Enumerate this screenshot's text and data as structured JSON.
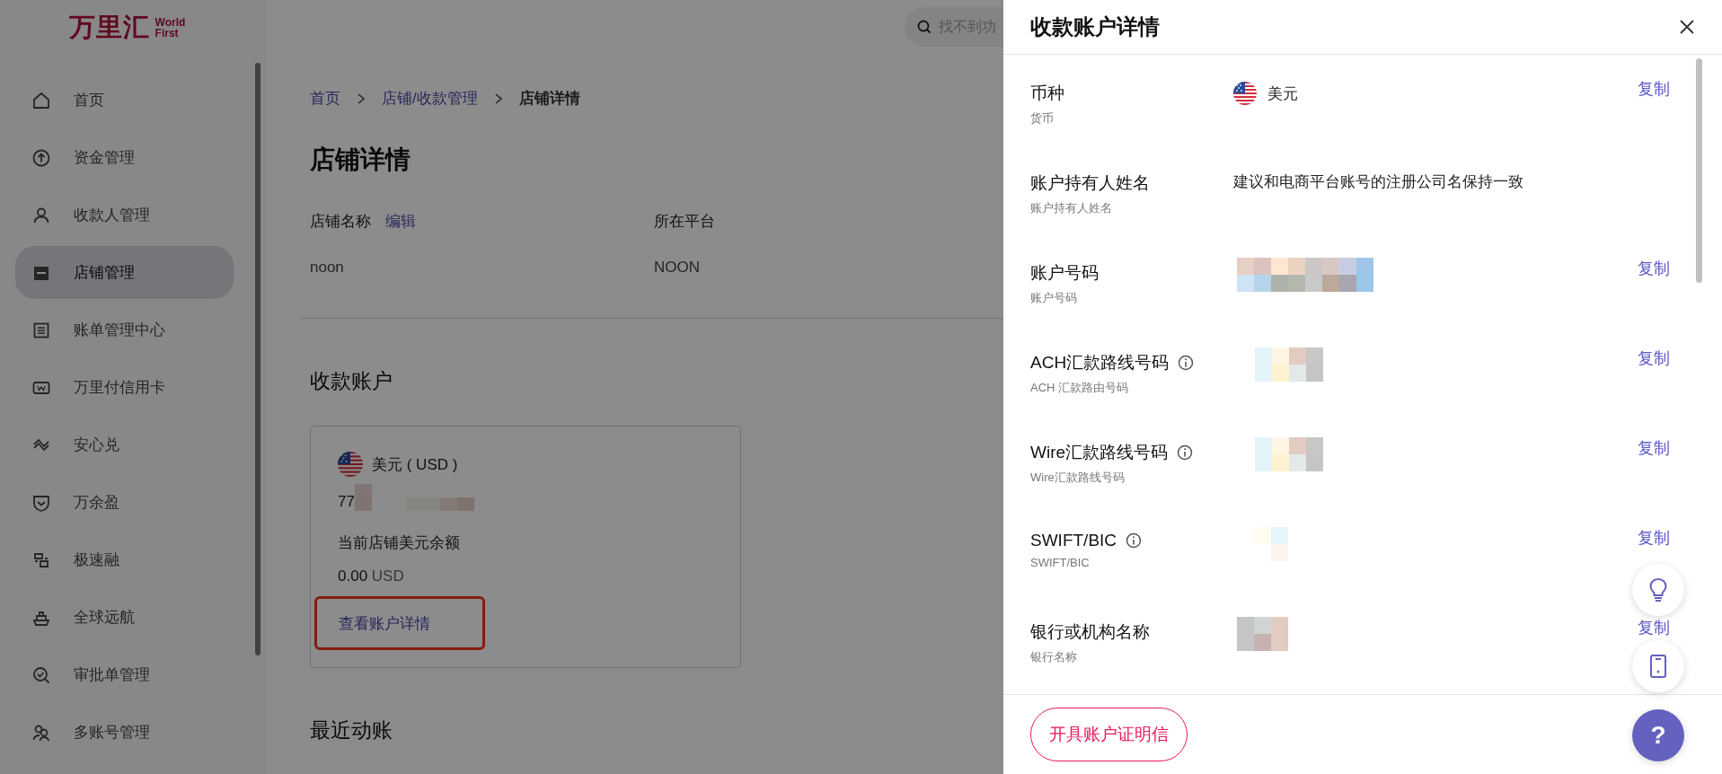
{
  "logo": {
    "name": "万里汇",
    "tagline_1": "World",
    "tagline_2": "First"
  },
  "sidebar": {
    "items": [
      {
        "label": "首页",
        "selected": false
      },
      {
        "label": "资金管理",
        "selected": false
      },
      {
        "label": "收款人管理",
        "selected": false
      },
      {
        "label": "店铺管理",
        "selected": true
      },
      {
        "label": "账单管理中心",
        "selected": false
      },
      {
        "label": "万里付信用卡",
        "selected": false
      },
      {
        "label": "安心兑",
        "selected": false
      },
      {
        "label": "万余盈",
        "selected": false
      },
      {
        "label": "极速融",
        "selected": false
      },
      {
        "label": "全球远航",
        "selected": false
      },
      {
        "label": "审批单管理",
        "selected": false
      },
      {
        "label": "多账号管理",
        "selected": false
      }
    ]
  },
  "search": {
    "placeholder": "找不到功"
  },
  "breadcrumbs": [
    {
      "label": "首页",
      "current": false
    },
    {
      "label": "店铺/收款管理",
      "current": false
    },
    {
      "label": "店铺详情",
      "current": true
    }
  ],
  "page_title": "店铺详情",
  "store_fields": [
    {
      "label": "店铺名称",
      "action": "编辑",
      "value": "noon"
    },
    {
      "label": "所在平台",
      "value": "NOON"
    }
  ],
  "accounts_section": {
    "title": "收款账户",
    "card": {
      "currency": "美元 ( USD )",
      "account_prefix": "77",
      "balance_label": "当前店铺美元余额",
      "balance_amount": "0.00",
      "balance_currency": "USD",
      "link": "查看账户详情",
      "highlighted": true
    }
  },
  "recent_section": {
    "title": "最近动账"
  },
  "drawer": {
    "title": "收款账户详情",
    "rows": [
      {
        "label": "币种",
        "sublabel": "货币",
        "info": false,
        "kind": "currency",
        "value": "美元",
        "copy": "复制"
      },
      {
        "label": "账户持有人姓名",
        "sublabel": "账户持有人姓名",
        "info": false,
        "kind": "text",
        "value": "建议和电商平台账号的注册公司名保持一致"
      },
      {
        "label": "账户号码",
        "sublabel": "账户号码",
        "info": false,
        "kind": "masked",
        "copy": "复制"
      },
      {
        "label": "ACH汇款路线号码",
        "sublabel": "ACH 汇款路由号码",
        "info": true,
        "kind": "masked",
        "copy": "复制"
      },
      {
        "label": "Wire汇款路线号码",
        "sublabel": "Wire汇款路线号码",
        "info": true,
        "kind": "masked",
        "copy": "复制"
      },
      {
        "label": "SWIFT/BIC",
        "sublabel": "SWIFT/BIC",
        "info": true,
        "kind": "masked",
        "copy": "复制"
      },
      {
        "label": "银行或机构名称",
        "sublabel": "银行名称",
        "info": false,
        "kind": "masked",
        "copy": "复制"
      }
    ],
    "footer_button": "开具账户证明信"
  },
  "help": {
    "label": "?"
  }
}
